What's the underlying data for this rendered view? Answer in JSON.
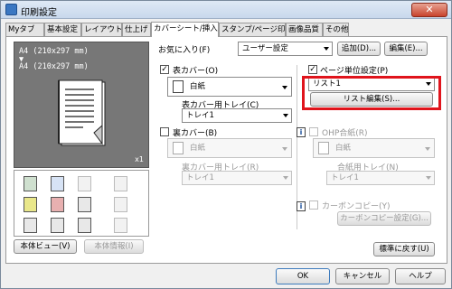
{
  "window": {
    "title": "印刷設定",
    "close_label": "✕"
  },
  "tabs": [
    "Myタブ",
    "基本設定",
    "レイアウト",
    "仕上げ",
    "カバーシート/挿入紙",
    "スタンプ/ページ印字",
    "画像品質",
    "その他"
  ],
  "favorites": {
    "label": "お気に入り(F)",
    "value": "ユーザー設定",
    "add_label": "追加(D)...",
    "edit_label": "編集(E)..."
  },
  "preview": {
    "line1": "A4 (210x297 mm)",
    "arrow": "▼",
    "line2": "A4 (210x297 mm)",
    "copies": "x1"
  },
  "left_buttons": {
    "body_view": "本体ビュー(V)",
    "body_info": "本体情報(I)"
  },
  "front_cover": {
    "checkbox_label": "表カバー(O)",
    "checked": true,
    "paper": "白紙",
    "tray_label": "表カバー用トレイ(C)",
    "tray_value": "トレイ1"
  },
  "back_cover": {
    "checkbox_label": "裏カバー(B)",
    "checked": false,
    "paper": "白紙",
    "tray_label": "裏カバー用トレイ(R)",
    "tray_value": "トレイ1"
  },
  "per_page": {
    "checkbox_label": "ページ単位設定(P)",
    "checked": true,
    "list_value": "リスト1",
    "edit_label": "リスト編集(S)..."
  },
  "ohp": {
    "checkbox_label": "OHP合紙(R)",
    "checked": false,
    "paper": "白紙",
    "tray_label": "合紙用トレイ(N)",
    "tray_value": "トレイ1"
  },
  "carbon": {
    "checkbox_label": "カーボンコピー(Y)",
    "checked": false,
    "settings_label": "カーボンコピー設定(G)..."
  },
  "defaults_label": "標準に戻す(U)",
  "footer": {
    "ok": "OK",
    "cancel": "キャンセル",
    "help": "ヘルプ"
  },
  "colors": {
    "highlight": "#e0141c",
    "panel": "#ffffff",
    "preview_bg": "#777777"
  }
}
